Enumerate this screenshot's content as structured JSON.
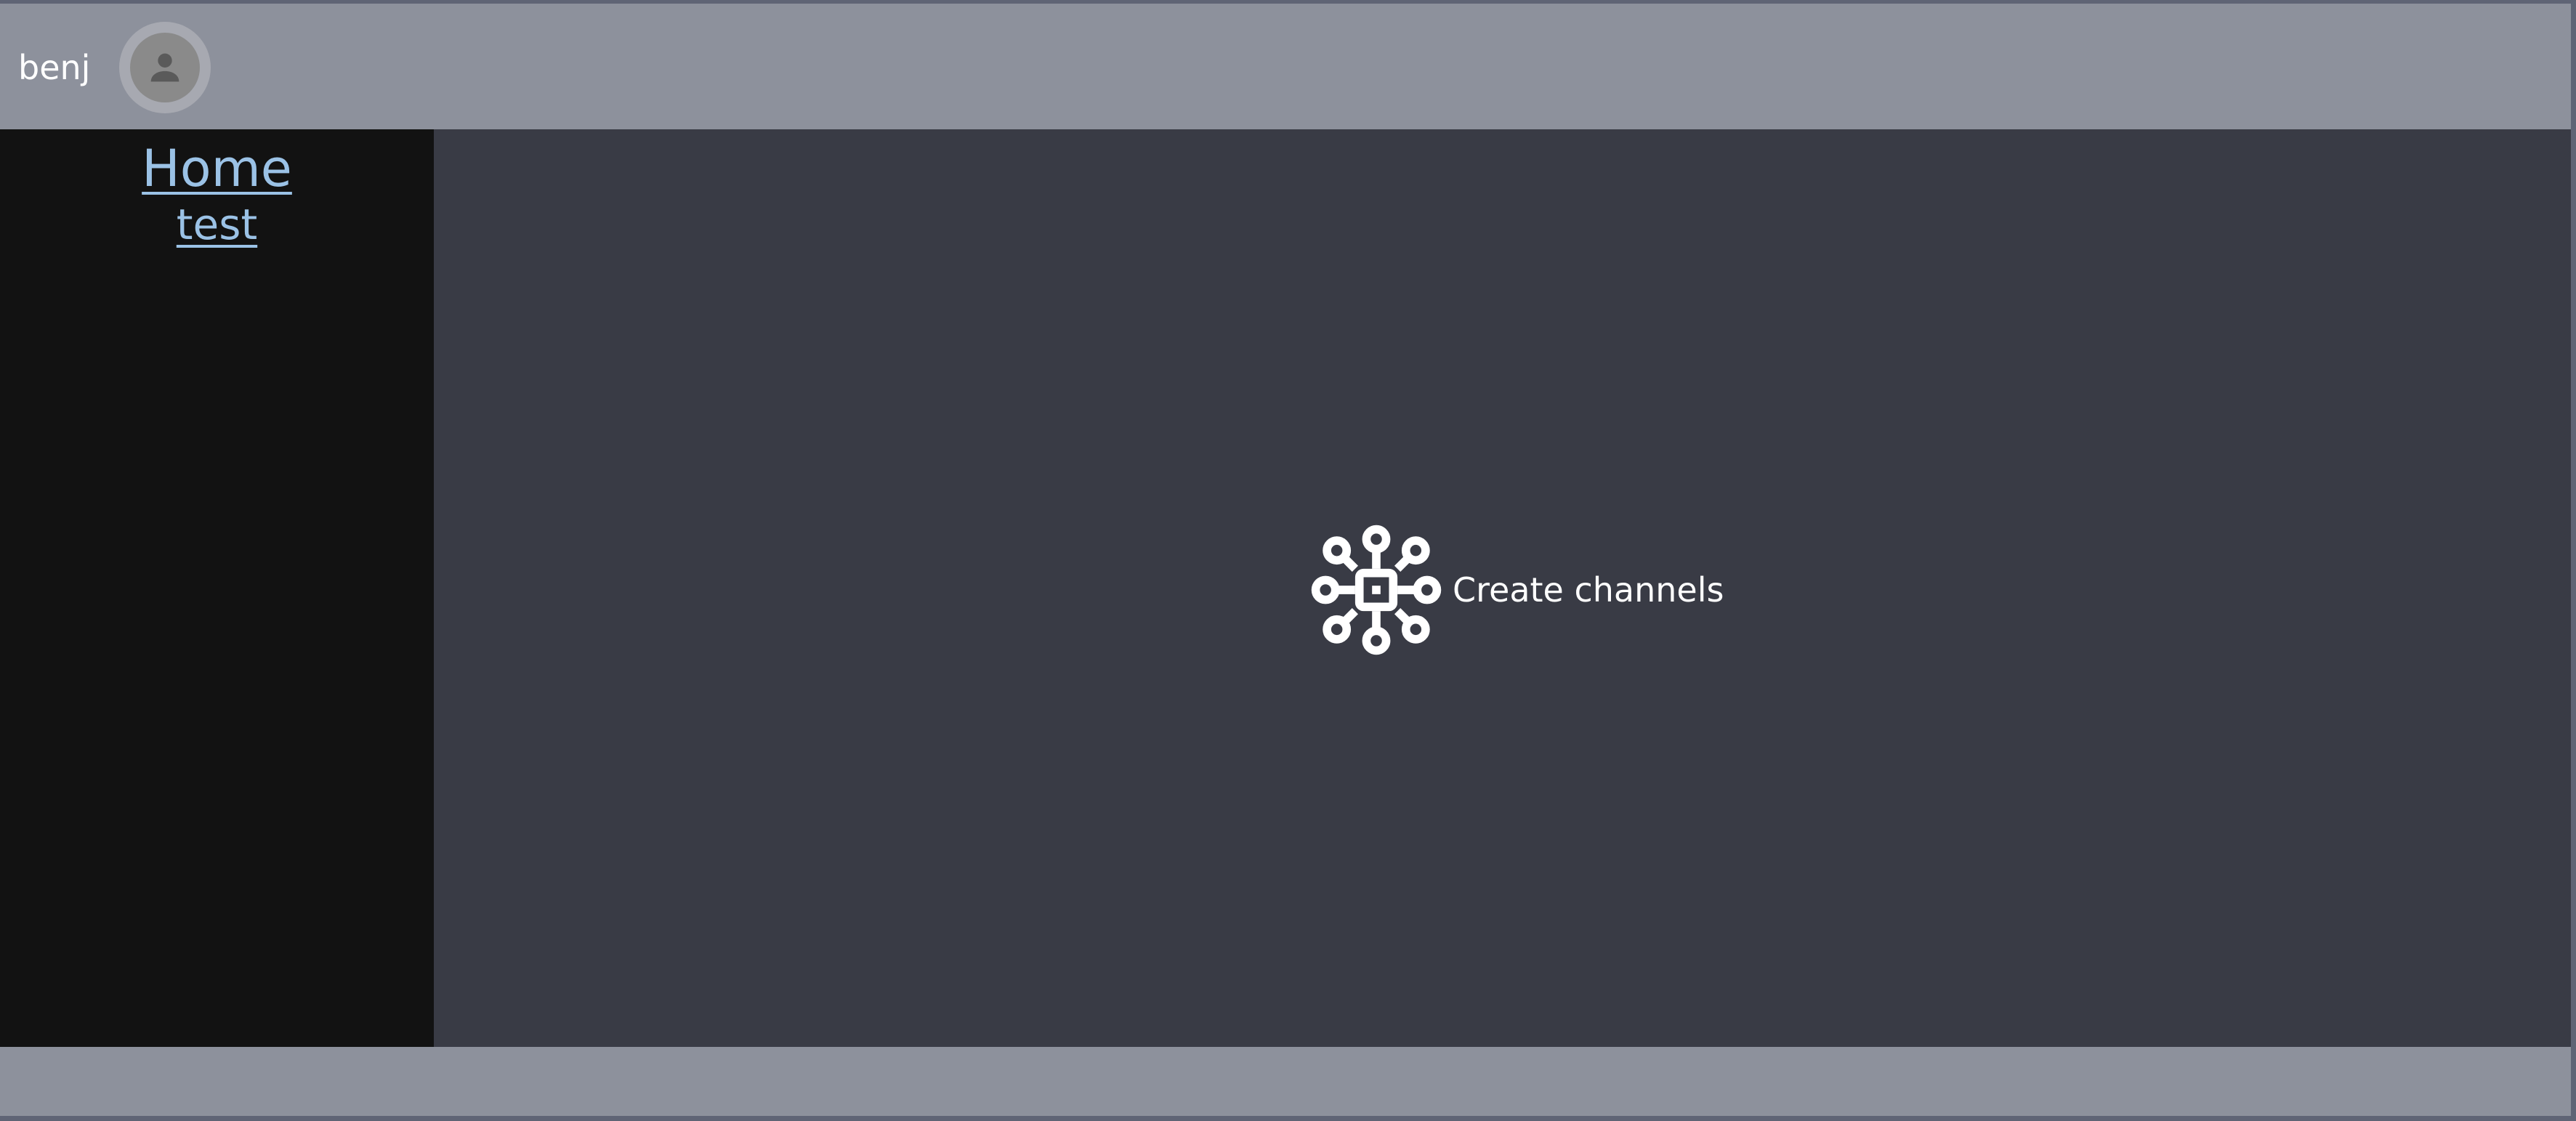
{
  "header": {
    "username": "benj",
    "avatar_icon": "person-icon"
  },
  "sidebar": {
    "items": [
      {
        "label": "Home"
      },
      {
        "label": "test"
      }
    ]
  },
  "main": {
    "empty_state": {
      "icon": "hub-icon",
      "label": "Create channels"
    }
  },
  "colors": {
    "frame": "#5f6475",
    "header_background": "#8d919c",
    "sidebar_background": "#121212",
    "main_background": "#393b45",
    "link": "#9bc2e6",
    "text": "#ffffff"
  }
}
